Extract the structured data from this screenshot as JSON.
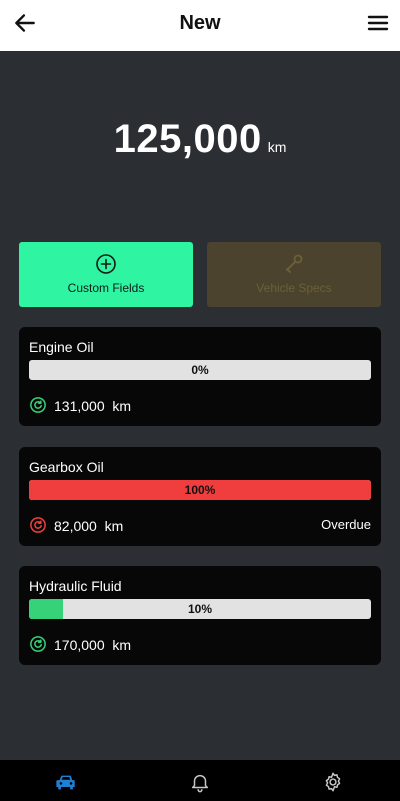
{
  "header": {
    "title": "New",
    "back_icon": "arrow-left-icon",
    "menu_icon": "hamburger-menu-icon"
  },
  "odometer": {
    "value": "125,000",
    "unit": "km"
  },
  "actions": {
    "custom_fields": {
      "label": "Custom Fields",
      "icon": "plus-circle-icon",
      "color": "#2ff5a3"
    },
    "vehicle": {
      "label": "Vehicle Specs",
      "icon": "wrench-icon",
      "color": "#4b432d"
    }
  },
  "items": [
    {
      "name": "Engine Oil",
      "progress": 0,
      "progress_label": "0%",
      "due_value": "131,000",
      "due_unit": "km",
      "status": "",
      "color": "#36d27a"
    },
    {
      "name": "Gearbox Oil",
      "progress": 1.0,
      "progress_label": "100%",
      "due_value": "82,000",
      "due_unit": "km",
      "status": "Overdue",
      "color": "#f03e3e"
    },
    {
      "name": "Hydraulic Fluid",
      "progress": 0.1,
      "progress_label": "10%",
      "due_value": "170,000",
      "due_unit": "km",
      "status": "",
      "color": "#36d27a"
    }
  ],
  "bottom_nav": [
    {
      "icon": "car-icon",
      "active": true,
      "color": "#1f7fd1"
    },
    {
      "icon": "bell-icon",
      "active": false,
      "color": "#c8c8c8"
    },
    {
      "icon": "gear-icon",
      "active": false,
      "color": "#c8c8c8"
    }
  ]
}
